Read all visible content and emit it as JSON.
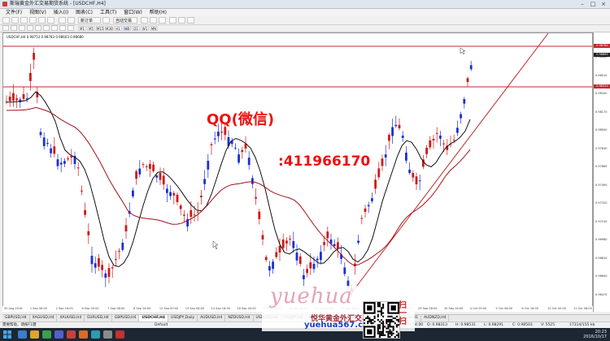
{
  "window": {
    "title": "斯瑞黄金外汇交易期货系统 - [USDCHF,H4]",
    "controls": [
      "–",
      "□",
      "×"
    ]
  },
  "menu": [
    "文件(F)",
    "视图(V)",
    "插入(I)",
    "图表(C)",
    "工具(T)",
    "窗口(W)",
    "帮助(H)"
  ],
  "toolbar": {
    "new_order_label": "新订单",
    "auto_trade_label": "自动交易"
  },
  "timeframes": [
    "M1",
    "M5",
    "M15",
    "M30",
    "H1",
    "H4",
    "D1",
    "W1",
    "MN"
  ],
  "chart": {
    "header": "USDCHF,H4  0.98753 0.98783 0.98603 0.98680",
    "watermark_line1": "QQ(微信)",
    "watermark_line2": ":411966170",
    "symbol": "USDCHF",
    "timeframe": "H4"
  },
  "price_scale": {
    "labels": [
      "0.98680",
      "0.98510",
      "0.98340",
      "0.98170",
      "0.98000",
      "0.97830",
      "0.97660",
      "0.97490",
      "0.97320",
      "0.97150",
      "0.96980",
      "0.96810",
      "0.96640",
      "0.96470"
    ],
    "tags": [
      "0.98780",
      "0.98680",
      "0.98320"
    ]
  },
  "time_axis": [
    "30 Aug 2016",
    "1 Sep 08:00",
    "2 Sep 16:00",
    "6 Sep 00:00",
    "7 Sep 08:00",
    "8 Sep 16:00",
    "12 Sep 00:00",
    "13 Sep 08:00",
    "14 Sep 16:00",
    "16 Sep 00:00",
    "19 Sep 08:00",
    "20 Sep 16:00",
    "22 Sep 00:00",
    "23 Sep 08:00",
    "26 Sep 16:00",
    "28 Sep 00:00",
    "29 Sep 08:00",
    "30 Sep 16:00",
    "4 Oct 00:00",
    "5 Oct 08:00",
    "6 Oct 16:00",
    "10 Oct 00:00",
    "11 Oct 08:00"
  ],
  "tabs": [
    "GBPUSD,H4",
    "XAGUSD,H4",
    "XAUUSD,H4",
    "EURUSD,H4",
    "GBPUSD,H4",
    "USDCHF,H4",
    "USDJPY,Daily",
    "AUDUSD,H4",
    "NZDUSD,H4",
    "USDCAD,H4",
    "CADJPY,H1",
    "CADCHF,H4",
    "AUDCAD,M15",
    "CADJPY,Daily",
    "AUDCAD,H1",
    "AUDNZD,H4"
  ],
  "active_tab": "USDCHF,H4",
  "status": {
    "help": "需要帮助，请按F1键",
    "profile": "Default",
    "datetime": "2016.10.11 04:00",
    "open": "O: 0.98313",
    "high": "H: 0.98531",
    "low": "L: 0.98291",
    "close": "C: 0.98503",
    "volume": "V: 5525",
    "traffic": "17314/155 kb"
  },
  "taskbar": {
    "time": "20:23",
    "date": "2016/10/17"
  },
  "brand": {
    "script": "yuehua",
    "cn": "悦华黄金外汇交易培训",
    "url": "yuehua567.com",
    "qr_caption": "扫一扫"
  },
  "chart_data": {
    "type": "candlestick",
    "symbol": "USDCHF",
    "timeframe": "H4",
    "ylim": [
      0.964,
      0.988
    ],
    "horizontal_lines": [
      0.9878,
      0.9832
    ],
    "series": [
      {
        "name": "",
        "color": "#000000"
      },
      {
        "name": "",
        "color": "#a3101a"
      }
    ],
    "trendline": {
      "color": "#c0282c"
    },
    "colors": {
      "bull": "#1a2fd6",
      "bear": "#d01818",
      "level": "#c0282c"
    }
  }
}
